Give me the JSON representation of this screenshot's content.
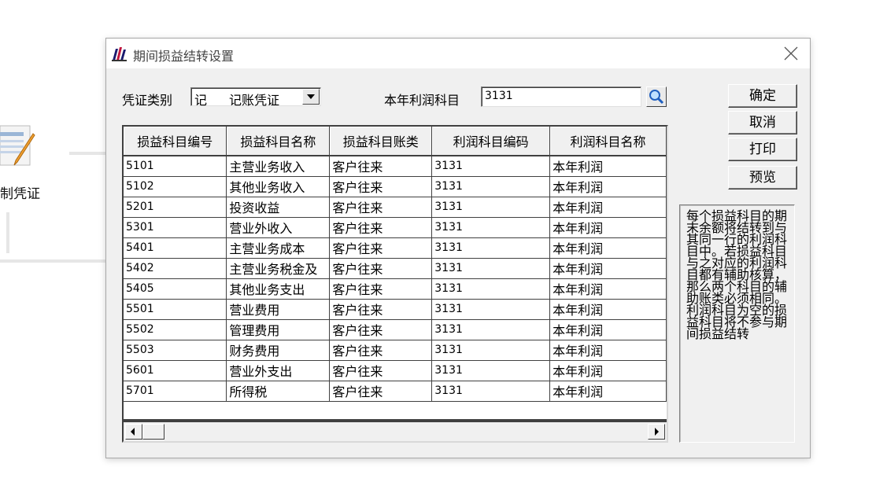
{
  "background": {
    "partial_label": "制凭证"
  },
  "dialog": {
    "title": "期间损益结转设置",
    "voucher_type_label": "凭证类别",
    "voucher_type": {
      "code": "记",
      "name": "记账凭证"
    },
    "profit_account_label": "本年利润科目",
    "profit_account_value": "3131",
    "buttons": {
      "ok": "确定",
      "cancel": "取消",
      "print": "打印",
      "preview": "预览"
    },
    "table": {
      "columns": [
        "损益科目编号",
        "损益科目名称",
        "损益科目账类",
        "利润科目编码",
        "利润科目名称"
      ],
      "rows": [
        [
          "5101",
          "主营业务收入",
          "客户往来",
          "3131",
          "本年利润"
        ],
        [
          "5102",
          "其他业务收入",
          "客户往来",
          "3131",
          "本年利润"
        ],
        [
          "5201",
          "投资收益",
          "客户往来",
          "3131",
          "本年利润"
        ],
        [
          "5301",
          "营业外收入",
          "客户往来",
          "3131",
          "本年利润"
        ],
        [
          "5401",
          "主营业务成本",
          "客户往来",
          "3131",
          "本年利润"
        ],
        [
          "5402",
          "主营业务税金及",
          "客户往来",
          "3131",
          "本年利润"
        ],
        [
          "5405",
          "其他业务支出",
          "客户往来",
          "3131",
          "本年利润"
        ],
        [
          "5501",
          "营业费用",
          "客户往来",
          "3131",
          "本年利润"
        ],
        [
          "5502",
          "管理费用",
          "客户往来",
          "3131",
          "本年利润"
        ],
        [
          "5503",
          "财务费用",
          "客户往来",
          "3131",
          "本年利润"
        ],
        [
          "5601",
          "营业外支出",
          "客户往来",
          "3131",
          "本年利润"
        ],
        [
          "5701",
          "所得税",
          "客户往来",
          "3131",
          "本年利润"
        ]
      ]
    },
    "note": "每个损益科目的期末余额将结转到与其同一行的利润科目中。若损益科目与之对应的利润科目都有辅助核算，那么两个科目的辅助账类必须相同。利润科目为空的损益科目将不参与期间损益结转"
  },
  "icons": [
    "app-books-icon",
    "close-icon",
    "search-icon",
    "voucher-edit-icon"
  ]
}
